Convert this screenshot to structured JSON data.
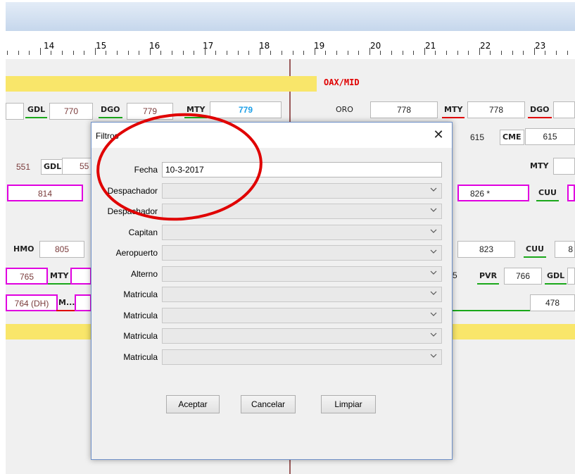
{
  "timeline": {
    "hours": [
      "14",
      "15",
      "16",
      "17",
      "18",
      "19",
      "20",
      "21",
      "22",
      "23"
    ],
    "route_label": "OAX/MID"
  },
  "rows": {
    "r1": {
      "s0": "770",
      "c1": "GDL",
      "c2": "DGO",
      "s1": "779",
      "c3": "MTY",
      "s2": "779",
      "c4": "ORO",
      "s3": "778",
      "c5": "MTY",
      "s4": "778",
      "c6": "DGO"
    },
    "r2": {
      "s1": "615",
      "c1": "CME",
      "s2": "615"
    },
    "r3": {
      "s0": "551",
      "c1": "GDL",
      "s1": "55",
      "c2": "MTY"
    },
    "r4": {
      "s0": "814",
      "s1": "826 *",
      "c1": "CUU"
    },
    "r5": {
      "c0": "HMO",
      "s0": "805",
      "s1": "823",
      "c1": "CUU",
      "s2": "8"
    },
    "r6": {
      "s0": "765",
      "c1": "MTY",
      "s1": "5",
      "c2": "PVR",
      "s2": "766",
      "c3": "GDL"
    },
    "r7": {
      "s0": "764 (DH)",
      "c1": "M...",
      "s1": "478"
    }
  },
  "dialog": {
    "title": "Filtros",
    "close_glyph": "✕",
    "fields": [
      {
        "label": "Fecha",
        "value": "10-3-2017",
        "kind": "text"
      },
      {
        "label": "Despachador",
        "value": "",
        "kind": "select"
      },
      {
        "label": "Despachador",
        "value": "",
        "kind": "select"
      },
      {
        "label": "Capitan",
        "value": "",
        "kind": "select"
      },
      {
        "label": "Aeropuerto",
        "value": "",
        "kind": "select"
      },
      {
        "label": "Alterno",
        "value": "",
        "kind": "select"
      },
      {
        "label": "Matricula",
        "value": "",
        "kind": "select"
      },
      {
        "label": "Matricula",
        "value": "",
        "kind": "select"
      },
      {
        "label": "Matricula",
        "value": "",
        "kind": "select"
      },
      {
        "label": "Matricula",
        "value": "",
        "kind": "select"
      }
    ],
    "buttons": {
      "accept": "Aceptar",
      "cancel": "Cancelar",
      "clear": "Limpiar"
    }
  },
  "colors": {
    "annotation": "#e00000",
    "route_bar": "#f9e66a",
    "highlight_border": "#e000e0",
    "accent_blue": "#1ea0e8"
  }
}
